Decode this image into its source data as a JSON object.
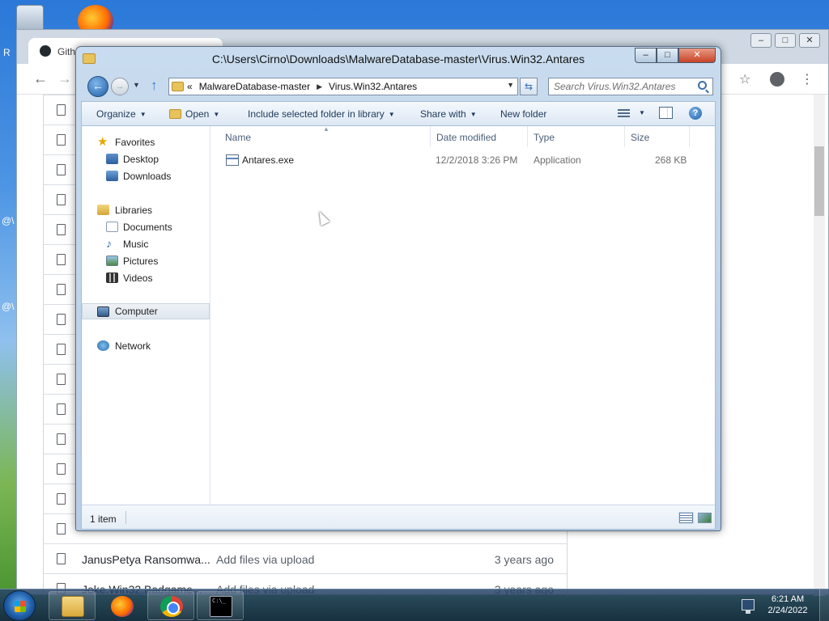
{
  "explorer": {
    "title": "C:\\Users\\Cirno\\Downloads\\MalwareDatabase-master\\Virus.Win32.Antares",
    "window_buttons": {
      "minimize": "–",
      "maximize": "□",
      "close": "✕"
    },
    "breadcrumb": [
      "MalwareDatabase-master",
      "Virus.Win32.Antares"
    ],
    "breadcrumb_prefix": "«",
    "search_placeholder": "Search Virus.Win32.Antares",
    "toolbar": {
      "organize": "Organize",
      "open": "Open",
      "include_library": "Include selected folder in library",
      "share_with": "Share with",
      "new_folder": "New folder"
    },
    "nav": {
      "favorites": "Favorites",
      "desktop": "Desktop",
      "downloads": "Downloads",
      "libraries": "Libraries",
      "documents": "Documents",
      "music": "Music",
      "pictures": "Pictures",
      "videos": "Videos",
      "computer": "Computer",
      "network": "Network"
    },
    "columns": {
      "name": "Name",
      "date": "Date modified",
      "type": "Type",
      "size": "Size"
    },
    "file": {
      "name": "Antares.exe",
      "date": "12/2/2018 3:26 PM",
      "type": "Application",
      "size": "268 KB"
    },
    "status": "1 item"
  },
  "browser": {
    "tab_title": "Gith",
    "rows": [
      {
        "name": "JanusPetya Ransomwa...",
        "message": "Add files via upload",
        "age": "3 years ago"
      },
      {
        "name": "Joke.Win32.Badgame...",
        "message": "Add files via upload",
        "age": "3 years ago"
      }
    ]
  },
  "desktop": {
    "left_labels": [
      "R",
      "@\\",
      "@\\"
    ]
  },
  "taskbar": {
    "time": "6:21 AM",
    "date": "2/24/2022"
  }
}
